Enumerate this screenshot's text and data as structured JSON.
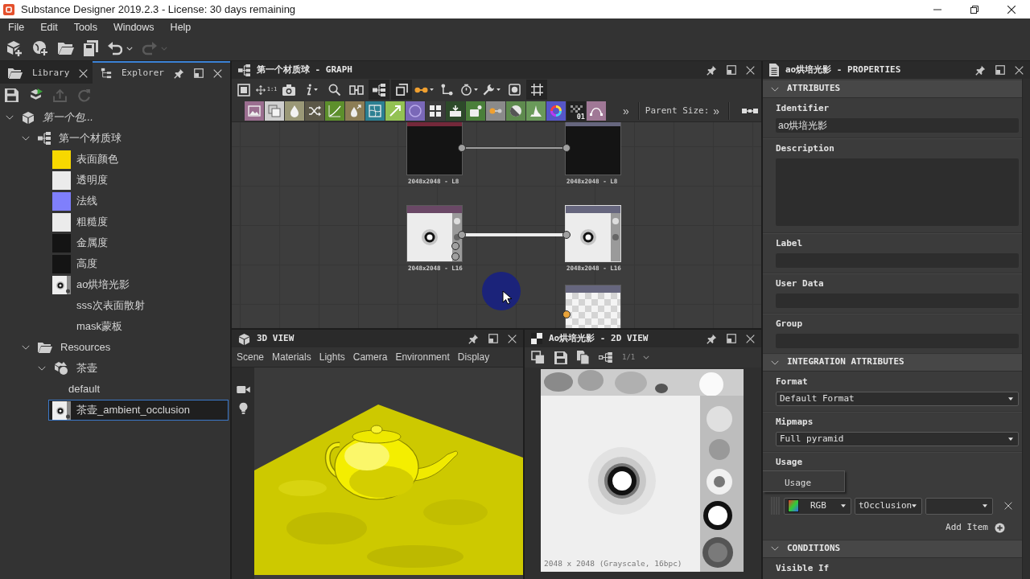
{
  "window": {
    "title": "Substance Designer 2019.2.3 - License: 30 days remaining"
  },
  "menu": [
    {
      "label": "File"
    },
    {
      "label": "Edit"
    },
    {
      "label": "Tools"
    },
    {
      "label": "Windows"
    },
    {
      "label": "Help"
    }
  ],
  "toolbar": [
    {
      "kind": "new-package",
      "disabled": false
    },
    {
      "kind": "new-graph",
      "disabled": false
    },
    {
      "kind": "open",
      "disabled": false
    },
    {
      "kind": "save-all",
      "disabled": false
    },
    {
      "kind": "undo",
      "disabled": false
    },
    {
      "kind": "redo",
      "disabled": true
    }
  ],
  "explorer": {
    "tabs": [
      {
        "label": "Library",
        "selected": false
      },
      {
        "label": "Explorer",
        "selected": true
      }
    ],
    "toolbar": [
      {
        "kind": "save",
        "disabled": false
      },
      {
        "kind": "publish",
        "disabled": false
      },
      {
        "kind": "export",
        "disabled": true
      },
      {
        "kind": "reload",
        "disabled": true
      }
    ],
    "tree": [
      {
        "kind": "package",
        "label": "第一个包...",
        "expanded": true,
        "selected": false,
        "children": [
          {
            "kind": "graph",
            "label": "第一个材质球",
            "expanded": true,
            "selected": false,
            "children": [
              {
                "kind": "swatch",
                "color": "#f7d800",
                "label": "表面颜色",
                "selected": false
              },
              {
                "kind": "swatch",
                "color": "#ebebeb",
                "label": "透明度",
                "selected": false
              },
              {
                "kind": "swatch",
                "color": "#7f7ffc",
                "label": "法线",
                "selected": false
              },
              {
                "kind": "swatch",
                "color": "#ebebeb",
                "label": "粗糙度",
                "selected": false
              },
              {
                "kind": "swatch",
                "color": "#141414",
                "label": "金属度",
                "selected": false
              },
              {
                "kind": "swatch",
                "color": "#141414",
                "label": "高度",
                "selected": false
              },
              {
                "kind": "image",
                "label": "ao烘培光影",
                "selected": false
              },
              {
                "kind": "empty",
                "label": "sss次表面散射",
                "selected": false
              },
              {
                "kind": "empty",
                "label": "mask蒙板",
                "selected": false
              }
            ]
          },
          {
            "kind": "folder",
            "label": "Resources",
            "expanded": true,
            "selected": false,
            "children": [
              {
                "kind": "mesh",
                "label": "茶壶",
                "expanded": true,
                "selected": false,
                "children": [
                  {
                    "kind": "plain",
                    "label": "default",
                    "selected": false
                  }
                ]
              },
              {
                "kind": "image",
                "label": "茶壶_ambient_occlusion",
                "selected": true
              }
            ]
          }
        ]
      }
    ]
  },
  "graph": {
    "title": "第一个材质球 - GRAPH",
    "tools": [
      {
        "kind": "frame",
        "on": false
      },
      {
        "kind": "fit",
        "caption": "1:1",
        "on": false
      },
      {
        "kind": "snapshot",
        "on": false
      },
      {
        "kind": "info",
        "on": false
      },
      {
        "kind": "search",
        "on": false
      },
      {
        "kind": "align",
        "on": false
      },
      {
        "kind": "hierarchy",
        "on": true
      },
      {
        "kind": "layers",
        "on": true
      },
      {
        "kind": "link",
        "on": false
      },
      {
        "kind": "connector",
        "on": false
      },
      {
        "kind": "timer",
        "on": false
      },
      {
        "kind": "tools",
        "on": false
      },
      {
        "kind": "display",
        "on": false
      },
      {
        "kind": "crop",
        "on": true
      }
    ],
    "palette": [
      {
        "kind": "image",
        "color": "#9b6e90"
      },
      {
        "kind": "layers",
        "color": "#cfcfcf"
      },
      {
        "kind": "drop",
        "color": "#9a9877"
      },
      {
        "kind": "shuffle",
        "color": "#5b5748"
      },
      {
        "kind": "curve",
        "color": "#5d8f2c"
      },
      {
        "kind": "drop-arrow",
        "color": "#8c7d55"
      },
      {
        "kind": "warp",
        "color": "#2c8092"
      },
      {
        "kind": "gradient",
        "color": "#93c253"
      },
      {
        "kind": "circle",
        "color": "#7a68b8"
      },
      {
        "kind": "grid",
        "color": "#3b3b3b"
      },
      {
        "kind": "import",
        "color": "#2d4a2a"
      },
      {
        "kind": "node",
        "color": "#4a7f3a"
      },
      {
        "kind": "dot-link",
        "color": "#8a8a8a"
      },
      {
        "kind": "half",
        "color": "#5e8a4e"
      },
      {
        "kind": "histogram",
        "color": "#6a9a5a"
      },
      {
        "kind": "wheel",
        "color": "#5656c8"
      },
      {
        "kind": "noise",
        "color": "#222222",
        "caption": "01"
      },
      {
        "kind": "bezier",
        "color": "#a07896"
      }
    ],
    "more": "»",
    "parent_size": {
      "label": "Parent Size:",
      "more": "»"
    },
    "nodes": [
      {
        "kind": "dark",
        "color": "#74283a",
        "selected": false,
        "caption": "2048x2048 - L8",
        "outputs": [
          {
            "color": "#a0a0a0",
            "link": {
              "selected": false
            }
          }
        ]
      },
      {
        "kind": "dark",
        "color": "#66667e",
        "selected": false,
        "caption": "2048x2048 - L8",
        "inputs": [
          {
            "color": "#a0a0a0"
          }
        ]
      },
      {
        "kind": "ao",
        "color": "#6a4866",
        "selected": false,
        "caption": "2048x2048 - L16",
        "outputs": [
          {
            "color": "#a0a0a0",
            "link": {
              "selected": true
            }
          },
          {
            "color": "#a0a0a0"
          },
          {
            "color": "#a0a0a0"
          }
        ]
      },
      {
        "kind": "ao",
        "color": "#66667e",
        "selected": true,
        "caption": "2048x2048 - L16",
        "inputs": [
          {
            "color": "#a0a0a0"
          }
        ]
      },
      {
        "kind": "checker",
        "color": "#66667e",
        "selected": false,
        "inputs": [
          {
            "color": "#e8a33a"
          }
        ]
      }
    ]
  },
  "view3d": {
    "title": "3D VIEW",
    "menu": [
      {
        "label": "Scene"
      },
      {
        "label": "Materials"
      },
      {
        "label": "Lights"
      },
      {
        "label": "Camera"
      },
      {
        "label": "Environment"
      },
      {
        "label": "Display"
      }
    ]
  },
  "view2d": {
    "title": "Ao烘培光影 - 2D VIEW",
    "toolbar": [
      {
        "kind": "copy",
        "disabled": false
      },
      {
        "kind": "save",
        "disabled": false
      },
      {
        "kind": "duplicate",
        "disabled": false
      },
      {
        "kind": "graph",
        "disabled": false
      },
      {
        "kind": "level",
        "label": "1/1",
        "disabled": true
      }
    ],
    "status": "2048 x 2048 (Grayscale, 16bpc)"
  },
  "properties": {
    "title": "ao烘培光影 - PROPERTIES",
    "sections": [
      {
        "title": "ATTRIBUTES",
        "expanded": true,
        "fields": [
          {
            "kind": "text",
            "label": "Identifier",
            "value": "ao烘培光影"
          },
          {
            "kind": "textarea",
            "label": "Description"
          },
          {
            "kind": "text",
            "label": "Label"
          },
          {
            "kind": "text",
            "label": "User Data"
          },
          {
            "kind": "text",
            "label": "Group"
          }
        ]
      },
      {
        "title": "INTEGRATION ATTRIBUTES",
        "expanded": true,
        "fields": [
          {
            "kind": "select",
            "label": "Format",
            "value": "Default Format"
          },
          {
            "kind": "select",
            "label": "Mipmaps",
            "value": "Full pyramid"
          },
          {
            "kind": "usage",
            "label": "Usage",
            "tooltip": "Usage",
            "items": [
              {
                "channel": "RGB",
                "usage": "tOcclusion"
              }
            ],
            "add_label": "Add Item"
          }
        ]
      },
      {
        "title": "CONDITIONS",
        "expanded": true,
        "fields": [
          {
            "kind": "heading",
            "label": "Visible If"
          }
        ]
      }
    ]
  }
}
